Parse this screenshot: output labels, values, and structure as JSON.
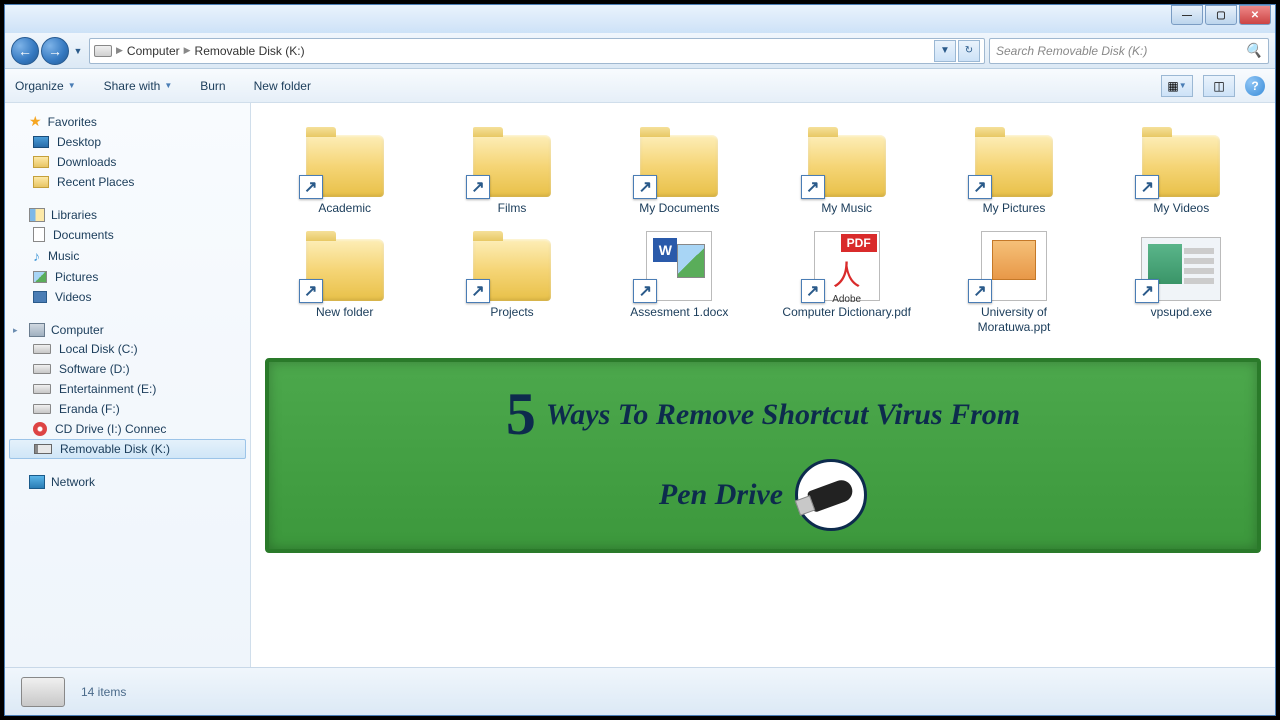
{
  "window_controls": {
    "min": "—",
    "max": "▢",
    "close": "✕"
  },
  "nav": {
    "back": "←",
    "forward": "→",
    "breadcrumb": [
      {
        "icon": "drive",
        "label": ""
      },
      {
        "label": "Computer"
      },
      {
        "label": "Removable Disk (K:)"
      }
    ]
  },
  "search": {
    "placeholder": "Search Removable Disk (K:)"
  },
  "toolbar": {
    "organize": "Organize",
    "share": "Share with",
    "burn": "Burn",
    "newfolder": "New folder"
  },
  "sidebar": {
    "favorites": {
      "title": "Favorites",
      "items": [
        "Desktop",
        "Downloads",
        "Recent Places"
      ]
    },
    "libraries": {
      "title": "Libraries",
      "items": [
        "Documents",
        "Music",
        "Pictures",
        "Videos"
      ]
    },
    "computer": {
      "title": "Computer",
      "items": [
        "Local Disk (C:)",
        "Software (D:)",
        "Entertainment (E:)",
        "Eranda (F:)",
        "CD Drive (I:) Connec",
        "Removable Disk (K:)"
      ]
    },
    "network": {
      "title": "Network"
    }
  },
  "files": [
    {
      "type": "folder",
      "label": "Academic"
    },
    {
      "type": "folder",
      "label": "Films"
    },
    {
      "type": "folder",
      "label": "My Documents"
    },
    {
      "type": "folder",
      "label": "My Music"
    },
    {
      "type": "folder",
      "label": "My Pictures"
    },
    {
      "type": "folder",
      "label": "My Videos"
    },
    {
      "type": "folder",
      "label": "New folder"
    },
    {
      "type": "folder",
      "label": "Projects"
    },
    {
      "type": "docx",
      "label": "Assesment 1.docx"
    },
    {
      "type": "pdf",
      "label": "Computer Dictionary.pdf"
    },
    {
      "type": "ppt",
      "label": "University of Moratuwa.ppt"
    },
    {
      "type": "exe",
      "label": "vpsupd.exe"
    }
  ],
  "banner": {
    "number": "5",
    "line1": "Ways To Remove Shortcut Virus From",
    "line2": "Pen Drive"
  },
  "status": {
    "count": "14 items"
  },
  "pdf_ui": {
    "badge": "PDF",
    "symbol": "人",
    "footer": "Adobe"
  }
}
